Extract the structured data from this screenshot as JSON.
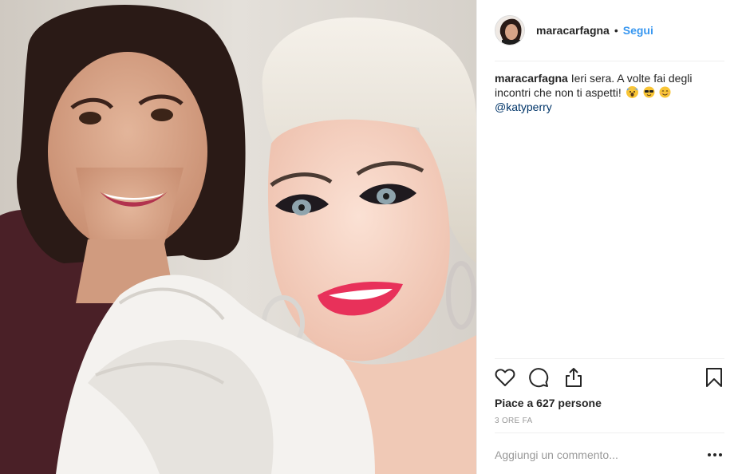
{
  "post": {
    "username": "maracarfagna",
    "separator": "•",
    "follow_label": "Segui",
    "caption": {
      "user": "maracarfagna",
      "text": "Ieri sera. A volte fai degli incontri che non ti aspetti!",
      "mention": "@katyperry",
      "emojis": [
        "screaming-face-emoji",
        "sunglasses-face-emoji",
        "smiling-face-emoji"
      ]
    },
    "likes_text": "Piace a 627 persone",
    "timestamp": "3 ORE FA",
    "comment_placeholder": "Aggiungi un commento...",
    "icons": {
      "like": "heart-icon",
      "comment": "comment-bubble-icon",
      "share": "share-icon",
      "save": "bookmark-icon",
      "more": "more-options-icon"
    },
    "colors": {
      "follow": "#3897f0",
      "mention": "#003569",
      "muted": "#999999",
      "lipstick": "#e8315a"
    }
  }
}
